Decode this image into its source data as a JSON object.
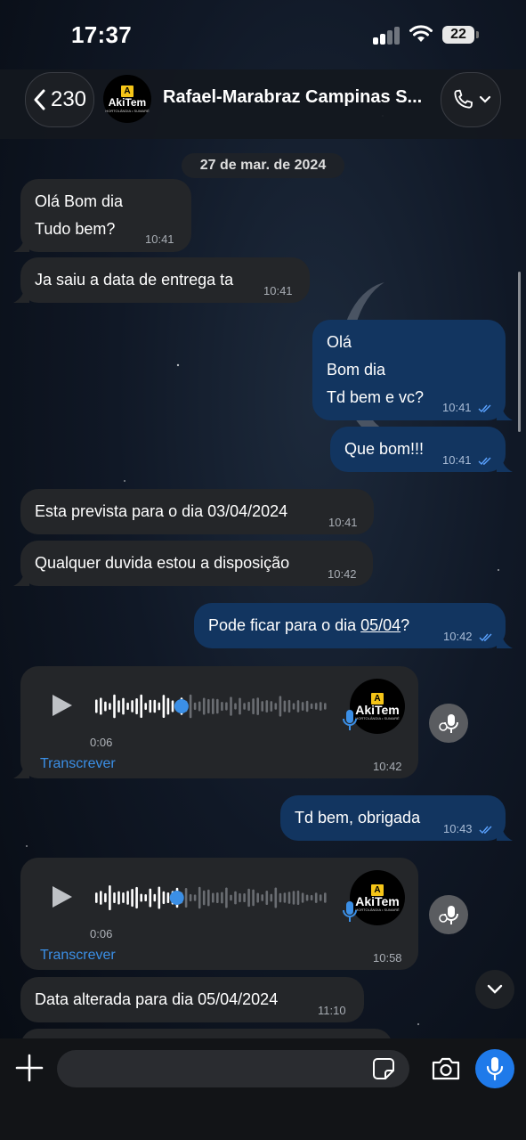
{
  "status_bar": {
    "time": "17:37",
    "battery": "22"
  },
  "header": {
    "back_count": "230",
    "contact_name": "Rafael-Marabraz Campinas S...",
    "logo_text": "AkiTem",
    "logo_letter": "A",
    "logo_sub": "HORTOLÂNDIA • SUMARÉ"
  },
  "chat": {
    "date_chip": "27 de mar. de 2024",
    "messages": [
      {
        "dir": "in",
        "text": "Olá Bom dia\nTudo bem?",
        "time": "10:41"
      },
      {
        "dir": "in",
        "text": "Ja saiu a data de entrega ta",
        "time": "10:41"
      },
      {
        "dir": "out",
        "text": "Olá\nBom dia\nTd bem e vc?",
        "time": "10:41"
      },
      {
        "dir": "out",
        "text": "Que bom!!!",
        "time": "10:41"
      },
      {
        "dir": "in",
        "text": "Esta prevista para o dia 03/04/2024",
        "time": "10:41"
      },
      {
        "dir": "in",
        "text": "Qualquer duvida estou a disposição",
        "time": "10:42"
      },
      {
        "dir": "out",
        "text_pre": "Pode ficar para o dia ",
        "text_link": "05/04",
        "text_post": "?",
        "time": "10:42"
      },
      {
        "dir": "in",
        "type": "voice",
        "duration": "0:06",
        "transcribe": "Transcrever",
        "time": "10:42",
        "progress": 0.37
      },
      {
        "dir": "out",
        "text": "Td bem, obrigada",
        "time": "10:43"
      },
      {
        "dir": "in",
        "type": "voice",
        "duration": "0:06",
        "transcribe": "Transcrever",
        "time": "10:58",
        "progress": 0.35
      },
      {
        "dir": "in",
        "text": "Data alterada para dia 05/04/2024",
        "time": "11:10"
      }
    ]
  },
  "colors": {
    "incoming": "#242629",
    "outgoing": "#123560",
    "accent": "#1f7aea",
    "read_tick": "#5aa2ff"
  },
  "icons": [
    "chevron-left-icon",
    "phone-icon",
    "chevron-down-icon",
    "play-icon",
    "mic-icon",
    "plus-icon",
    "sticker-icon",
    "camera-icon"
  ]
}
